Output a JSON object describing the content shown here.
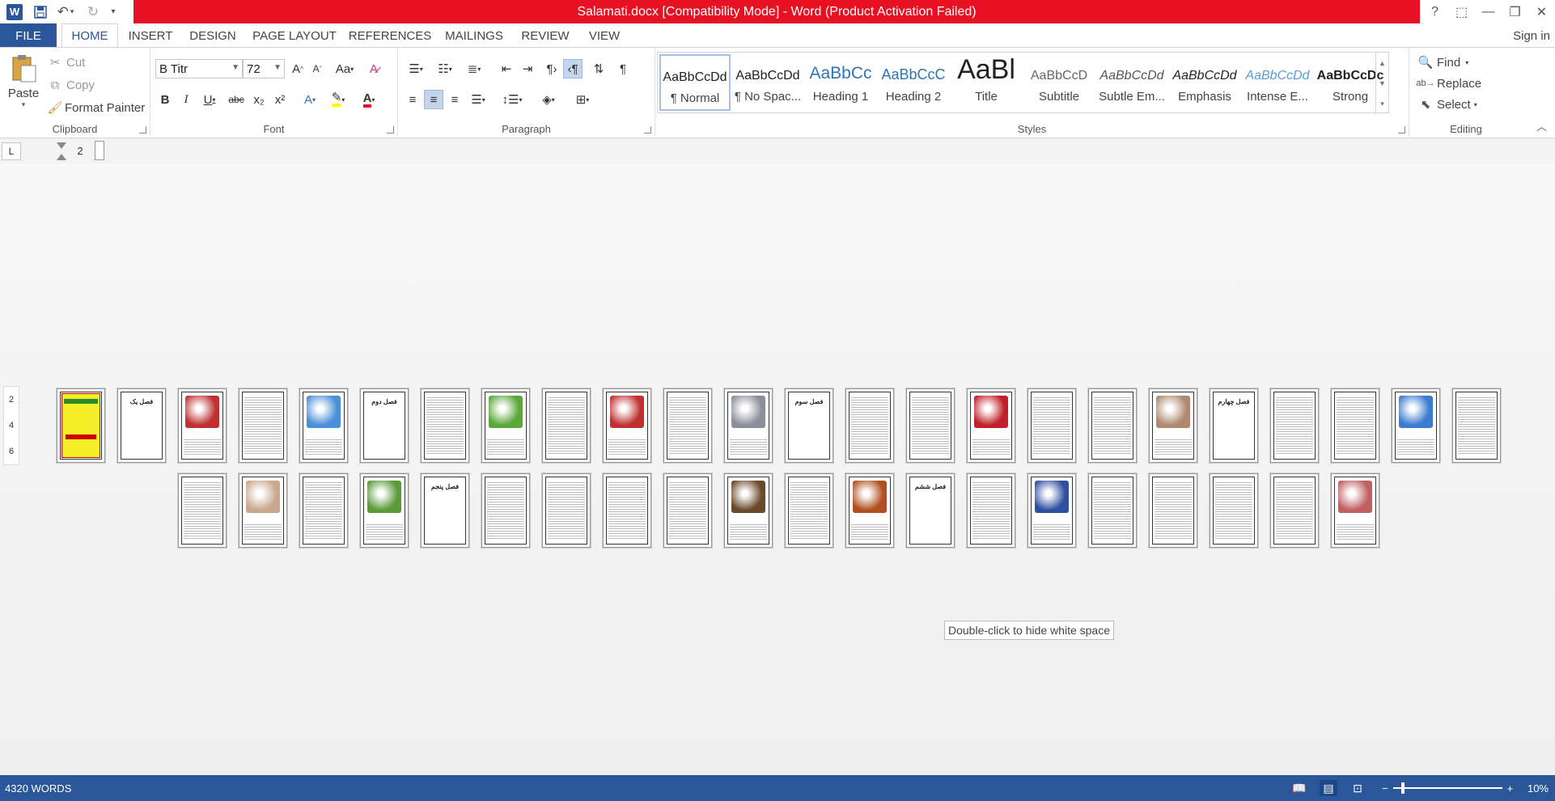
{
  "window": {
    "title": "Salamati.docx [Compatibility Mode] -  Word (Product Activation Failed)",
    "title_bg": "#e81123",
    "qat": {
      "save_icon": "save-icon",
      "undo_icon": "undo-icon",
      "redo_icon": "redo-icon"
    },
    "controls": {
      "help": "?",
      "restore_ribbon": "⬚",
      "minimize": "—",
      "restore": "❐",
      "close": "✕"
    }
  },
  "tabs": {
    "file": "FILE",
    "home": "HOME",
    "insert": "INSERT",
    "design": "DESIGN",
    "page_layout": "PAGE LAYOUT",
    "references": "REFERENCES",
    "mailings": "MAILINGS",
    "review": "REVIEW",
    "view": "VIEW",
    "sign_in": "Sign in"
  },
  "clipboard": {
    "paste": "Paste",
    "cut": "Cut",
    "copy": "Copy",
    "format_painter": "Format Painter",
    "label": "Clipboard"
  },
  "font": {
    "name": "B Titr",
    "size": "72",
    "label": "Font",
    "bold": "B",
    "italic": "I",
    "underline": "U",
    "strike": "abc",
    "sub": "x₂",
    "sup": "x²",
    "case": "Aa",
    "grow": "A",
    "shrink": "A"
  },
  "paragraph": {
    "label": "Paragraph"
  },
  "styles": {
    "label": "Styles",
    "items": [
      {
        "preview": "AaBbCcDd",
        "name": "¶ Normal"
      },
      {
        "preview": "AaBbCcDd",
        "name": "¶ No Spac..."
      },
      {
        "preview": "AaBbCc",
        "name": "Heading 1"
      },
      {
        "preview": "AaBbCcC",
        "name": "Heading 2"
      },
      {
        "preview": "AaBl",
        "name": "Title"
      },
      {
        "preview": "AaBbCcD",
        "name": "Subtitle"
      },
      {
        "preview": "AaBbCcDd",
        "name": "Subtle Em..."
      },
      {
        "preview": "AaBbCcDd",
        "name": "Emphasis"
      },
      {
        "preview": "AaBbCcDd",
        "name": "Intense E..."
      },
      {
        "preview": "AaBbCcDc",
        "name": "Strong"
      }
    ]
  },
  "editing": {
    "label": "Editing",
    "find": "Find",
    "replace": "Replace",
    "select": "Select"
  },
  "ruler": {
    "tab_selector": "L",
    "h_mark": "2",
    "v_marks": [
      "2",
      "4",
      "6"
    ]
  },
  "document": {
    "row1_count": 24,
    "row2_count": 20,
    "row1_chapters": {
      "1": "فصل یک",
      "5": "فصل دوم",
      "12": "فصل سوم",
      "19": "فصل چهارم"
    },
    "row2_chapters": {
      "4": "فصل پنجم",
      "12": "فصل ششم"
    },
    "tooltip": "Double-click to hide white space"
  },
  "status": {
    "words": "4320 WORDS",
    "zoom": "10%"
  }
}
